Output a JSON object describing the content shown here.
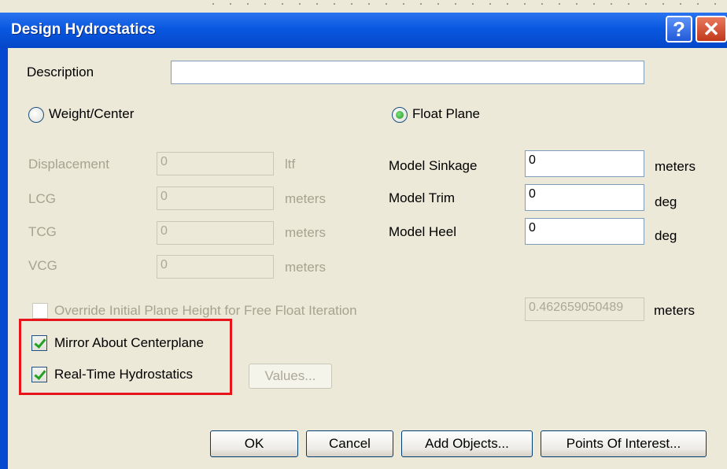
{
  "window": {
    "title": "Design Hydrostatics",
    "help_icon": "?",
    "close_icon": "✕"
  },
  "description": {
    "label": "Description",
    "value": ""
  },
  "mode": {
    "weight_center_label": "Weight/Center",
    "float_plane_label": "Float Plane",
    "selected": "Float Plane"
  },
  "weight": {
    "displacement": {
      "label": "Displacement",
      "value": "0",
      "unit": "ltf"
    },
    "lcg": {
      "label": "LCG",
      "value": "0",
      "unit": "meters"
    },
    "tcg": {
      "label": "TCG",
      "value": "0",
      "unit": "meters"
    },
    "vcg": {
      "label": "VCG",
      "value": "0",
      "unit": "meters"
    }
  },
  "float": {
    "sinkage": {
      "label": "Model Sinkage",
      "value": "0",
      "unit": "meters"
    },
    "trim": {
      "label": "Model Trim",
      "value": "0",
      "unit": "deg"
    },
    "heel": {
      "label": "Model Heel",
      "value": "0",
      "unit": "deg"
    }
  },
  "override": {
    "label": "Override Initial Plane Height for Free Float Iteration",
    "value": "0.462659050489",
    "unit": "meters",
    "checked": false
  },
  "options": {
    "mirror_label": "Mirror About Centerplane",
    "mirror_checked": true,
    "realtime_label": "Real-Time Hydrostatics",
    "realtime_checked": true,
    "values_button": "Values..."
  },
  "buttons": {
    "ok": "OK",
    "cancel": "Cancel",
    "add_objects": "Add Objects...",
    "points_of_interest": "Points Of Interest..."
  },
  "colors": {
    "titlebar": "#0a58e0",
    "highlight": "#e8141c",
    "dialog_bg": "#ece9d8"
  }
}
